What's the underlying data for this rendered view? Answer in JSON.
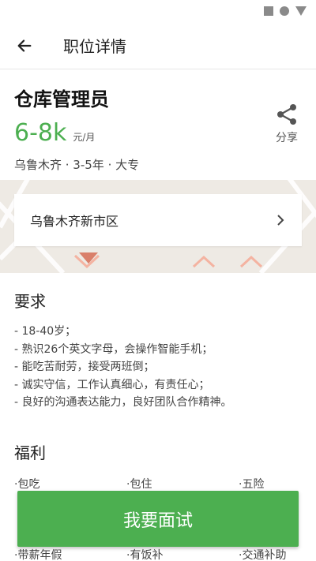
{
  "header": {
    "title": "职位详情"
  },
  "job": {
    "title": "仓库管理员",
    "salary": "6-8k",
    "salary_unit": "元/月",
    "meta": "乌鲁木齐 · 3-5年 · 大专"
  },
  "share": {
    "label": "分享"
  },
  "location": {
    "text": "乌鲁木齐新市区"
  },
  "requirements": {
    "title": "要求",
    "items": [
      "- 18-40岁；",
      "- 熟识26个英文字母，会操作智能手机；",
      "- 能吃苦耐劳，接受两班倒；",
      "- 诚实守信，工作认真细心，有责任心；",
      "- 良好的沟通表达能力，良好团队合作精神。"
    ]
  },
  "benefits": {
    "title": "福利",
    "items": [
      "·包吃",
      "·包住",
      "·五险"
    ],
    "bottom_items": [
      "·带薪年假",
      "·有饭补",
      "·交通补助"
    ]
  },
  "cta": {
    "label": "我要面试"
  },
  "colors": {
    "accent": "#4caf50",
    "map_bg": "#eeeae4"
  }
}
